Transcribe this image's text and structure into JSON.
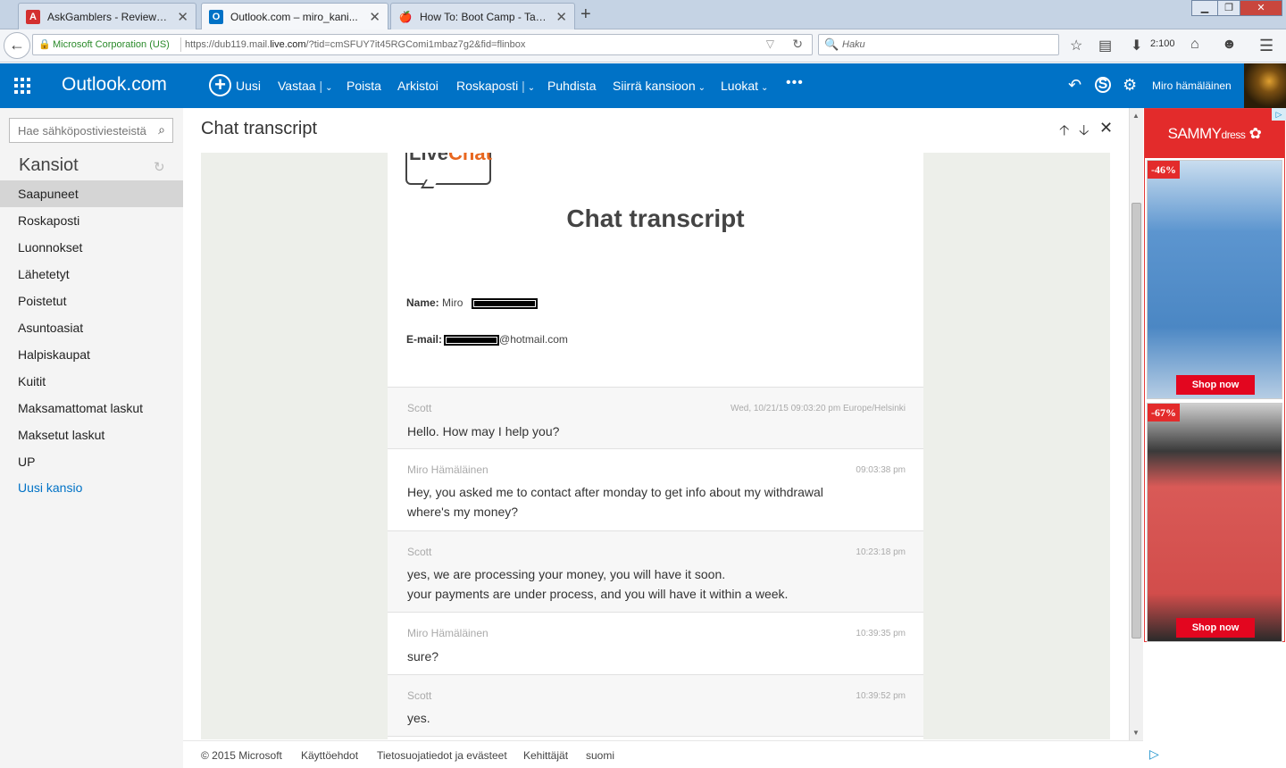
{
  "browser": {
    "tabs": [
      {
        "title": "AskGamblers - Reviews of ...",
        "favicon": "A",
        "favicon_color": "#d32f2f"
      },
      {
        "title": "Outlook.com – miro_kani...",
        "favicon": "O",
        "favicon_color": "#0072c6"
      },
      {
        "title": "How To: Boot Camp - Taki...",
        "favicon": "🍎",
        "favicon_color": "#f0a030"
      }
    ],
    "identity": "Microsoft Corporation (US)",
    "url_prefix": "https://dub119.mail.",
    "url_domain": "live.com",
    "url_suffix": "/?tid=cmSFUY7it45RGComi1mbaz7g2&fid=flinbox",
    "search_placeholder": "Haku",
    "download_label": "2:100"
  },
  "header": {
    "brand": "Outlook.com",
    "commands": [
      "Uusi",
      "Vastaa",
      "Poista",
      "Arkistoi",
      "Roskaposti",
      "Puhdista",
      "Siirrä kansioon",
      "Luokat"
    ],
    "user": "Miro hämäläinen",
    "accent": "#0072c6"
  },
  "sidebar": {
    "search_placeholder": "Hae sähköpostiviesteistä",
    "heading": "Kansiot",
    "folders": [
      "Saapuneet",
      "Roskaposti",
      "Luonnokset",
      "Lähetetyt",
      "Poistetut",
      "Asuntoasiat",
      "Halpiskaupat",
      "Kuitit",
      "Maksamattomat laskut",
      "Maksetut laskut",
      "UP"
    ],
    "selected": "Saapuneet",
    "new_folder": "Uusi kansio"
  },
  "message": {
    "subject": "Chat transcript",
    "logo_text_a": "Live",
    "logo_text_b": "Chat",
    "title": "Chat transcript",
    "name_label": "Name:",
    "name_value": "Miro",
    "email_label": "E-mail:",
    "email_suffix": "@hotmail.com",
    "chat": [
      {
        "who": "Scott",
        "when": "Wed, 10/21/15 09:03:20 pm Europe/Helsinki",
        "lines": [
          "Hello. How may I help you?"
        ]
      },
      {
        "who": "Miro Hämäläinen",
        "when": "09:03:38 pm",
        "lines": [
          "Hey, you asked me to contact after monday to get info about my withdrawal",
          "where's my money?"
        ]
      },
      {
        "who": "Scott",
        "when": "10:23:18 pm",
        "lines": [
          "yes, we are processing your money, you will have it soon.",
          "your payments are under process, and you will have it within a week."
        ]
      },
      {
        "who": "Miro Hämäläinen",
        "when": "10:39:35 pm",
        "lines": [
          "sure?"
        ]
      },
      {
        "who": "Scott",
        "when": "10:39:52 pm",
        "lines": [
          "yes."
        ]
      }
    ]
  },
  "footer": {
    "links": [
      "© 2015 Microsoft",
      "Käyttöehdot",
      "Tietosuojatiedot ja evästeet",
      "Kehittäjät",
      "suomi"
    ]
  },
  "ad": {
    "brand_a": "SAMMY",
    "brand_b": "dress",
    "products": [
      {
        "discount": "-46%",
        "cta": "Shop now"
      },
      {
        "discount": "-67%",
        "cta": "Shop now"
      }
    ]
  }
}
